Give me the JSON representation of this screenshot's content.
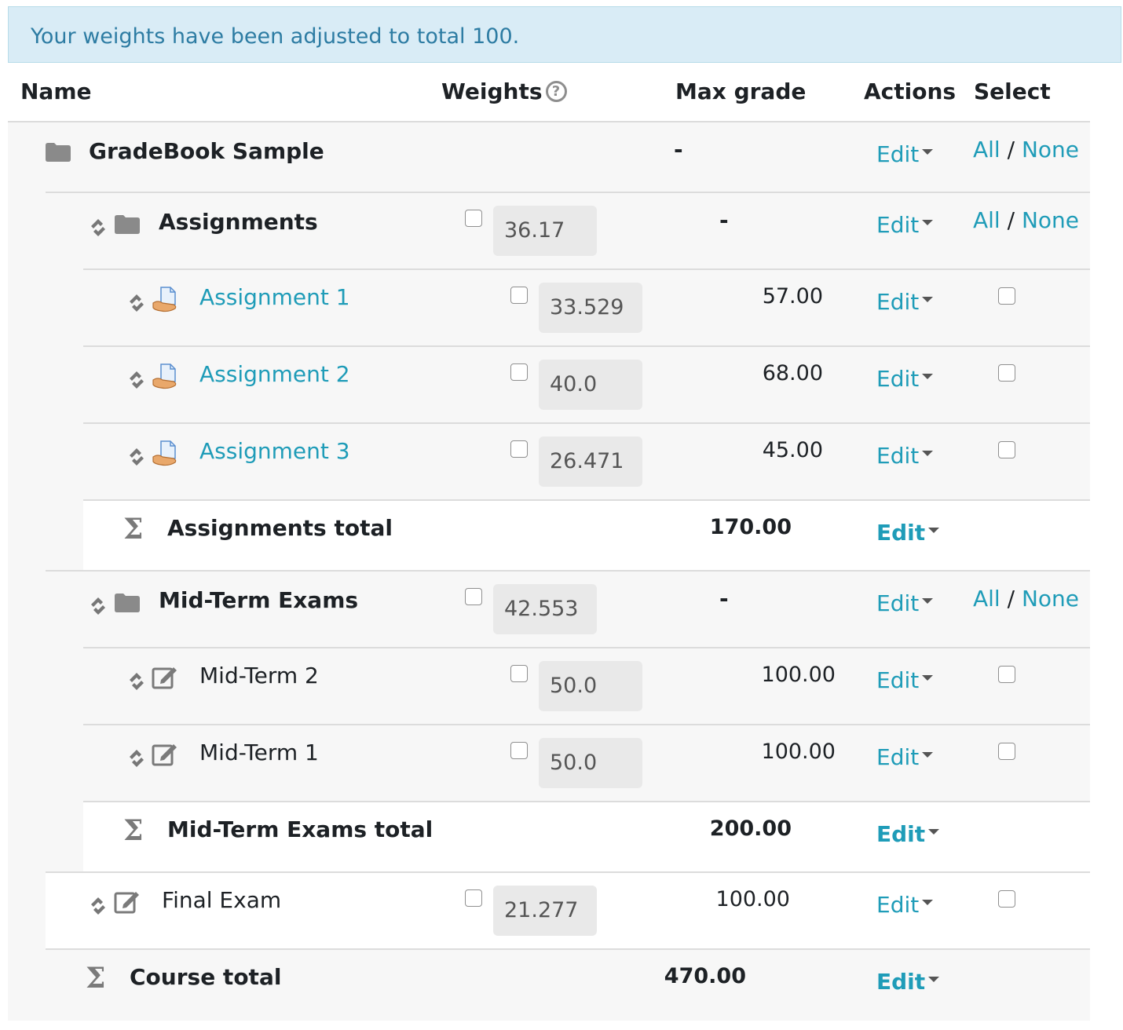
{
  "alert": {
    "message": "Your weights have been adjusted to total 100."
  },
  "headers": {
    "name": "Name",
    "weights": "Weights",
    "max_grade": "Max grade",
    "actions": "Actions",
    "select": "Select"
  },
  "help_glyph": "?",
  "edit_label": "Edit",
  "all_label": "All",
  "slash": "/",
  "none_label": "None",
  "sigma_glyph": "Σ",
  "rows": {
    "gradebook": {
      "name": "GradeBook Sample",
      "max_grade": "-"
    },
    "assignments": {
      "name": "Assignments",
      "weight": "36.17",
      "max_grade": "-"
    },
    "assignment1": {
      "name": "Assignment 1",
      "weight": "33.529",
      "max_grade": "57.00"
    },
    "assignment2": {
      "name": "Assignment 2",
      "weight": "40.0",
      "max_grade": "68.00"
    },
    "assignment3": {
      "name": "Assignment 3",
      "weight": "26.471",
      "max_grade": "45.00"
    },
    "assignments_total": {
      "name": "Assignments total",
      "max_grade": "170.00"
    },
    "midterms": {
      "name": "Mid-Term Exams",
      "weight": "42.553",
      "max_grade": "-"
    },
    "midterm2": {
      "name": "Mid-Term 2",
      "weight": "50.0",
      "max_grade": "100.00"
    },
    "midterm1": {
      "name": "Mid-Term 1",
      "weight": "50.0",
      "max_grade": "100.00"
    },
    "midterms_total": {
      "name": "Mid-Term Exams total",
      "max_grade": "200.00"
    },
    "final_exam": {
      "name": "Final Exam",
      "weight": "21.277",
      "max_grade": "100.00"
    },
    "course_total": {
      "name": "Course total",
      "max_grade": "470.00"
    }
  },
  "colors": {
    "link": "#1f9cb8",
    "alert_bg": "#d9ecf6",
    "alert_text": "#2d7ca3"
  },
  "icons": [
    "folder-icon",
    "move-icon",
    "assignment-icon",
    "edit-item-icon",
    "sigma-icon",
    "help-icon",
    "caret-down-icon"
  ]
}
